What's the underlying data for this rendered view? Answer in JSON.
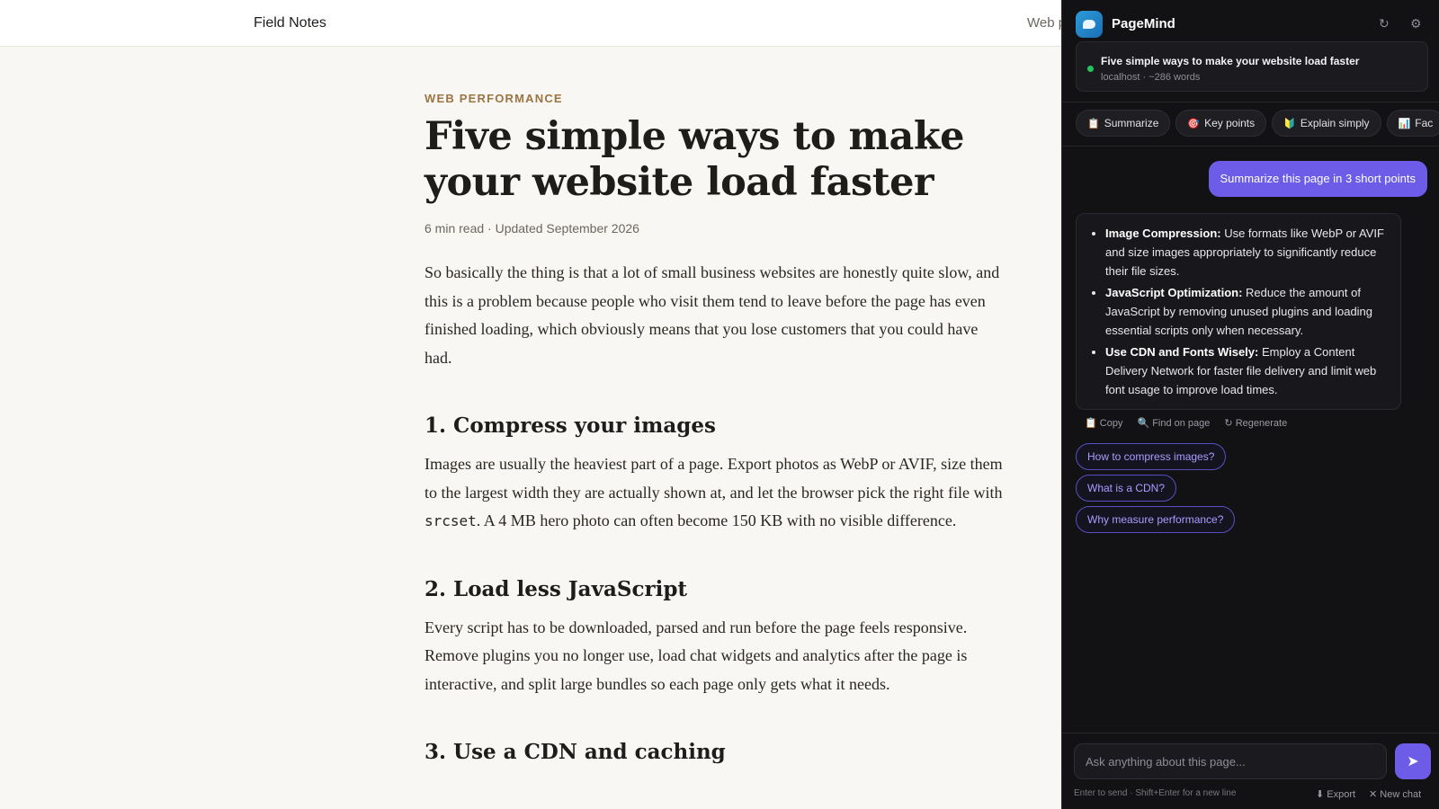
{
  "site": {
    "brand": "Field Notes",
    "nav_link": "Web p"
  },
  "article": {
    "kicker": "WEB PERFORMANCE",
    "title": "Five simple ways to make your website load faster",
    "meta": "6 min read · Updated September 2026",
    "intro": "So basically the thing is that a lot of small business websites are honestly quite slow, and this is a problem because people who visit them tend to leave before the page has even finished loading, which obviously means that you lose customers that you could have had.",
    "sections": [
      {
        "heading": "1. Compress your images",
        "body_before_code": "Images are usually the heaviest part of a page. Export photos as WebP or AVIF, size them to the largest width they are actually shown at, and let the browser pick the right file with ",
        "code": "srcset",
        "body_after_code": ". A 4 MB hero photo can often become 150 KB with no visible difference."
      },
      {
        "heading": "2. Load less JavaScript",
        "body": "Every script has to be downloaded, parsed and run before the page feels responsive. Remove plugins you no longer use, load chat widgets and analytics after the page is interactive, and split large bundles so each page only gets what it needs."
      },
      {
        "heading": "3. Use a CDN and caching"
      }
    ]
  },
  "panel": {
    "app_name": "PageMind",
    "header_icons": {
      "refresh": "↻",
      "settings": "⚙"
    },
    "page_card": {
      "title": "Five simple ways to make your website load faster",
      "subtitle": "localhost · ~286 words"
    },
    "quick_actions": [
      {
        "icon": "📋",
        "label": "Summarize"
      },
      {
        "icon": "🎯",
        "label": "Key points"
      },
      {
        "icon": "🔰",
        "label": "Explain simply"
      },
      {
        "icon": "📊",
        "label": "Fac"
      }
    ],
    "user_message": "Summarize this page in 3 short points",
    "reply_points": [
      {
        "bold": "Image Compression:",
        "text": " Use formats like WebP or AVIF and size images appropriately to significantly reduce their file sizes."
      },
      {
        "bold": "JavaScript Optimization:",
        "text": " Reduce the amount of JavaScript by removing unused plugins and loading essential scripts only when necessary."
      },
      {
        "bold": "Use CDN and Fonts Wisely:",
        "text": " Employ a Content Delivery Network for faster file delivery and limit web font usage to improve load times."
      }
    ],
    "reply_actions": {
      "copy": "📋 Copy",
      "find": "🔍 Find on page",
      "regenerate": "↻ Regenerate"
    },
    "suggestions": [
      "How to compress images?",
      "What is a CDN?",
      "Why measure performance?"
    ],
    "composer": {
      "placeholder": "Ask anything about this page...",
      "send": "➤",
      "hint": "Enter to send · Shift+Enter for a new line",
      "export": "⬇ Export",
      "new_chat": "✕ New chat"
    },
    "colors": {
      "accent": "#6d5ce8",
      "live": "#22c55e",
      "kicker": "#9a7443"
    }
  }
}
